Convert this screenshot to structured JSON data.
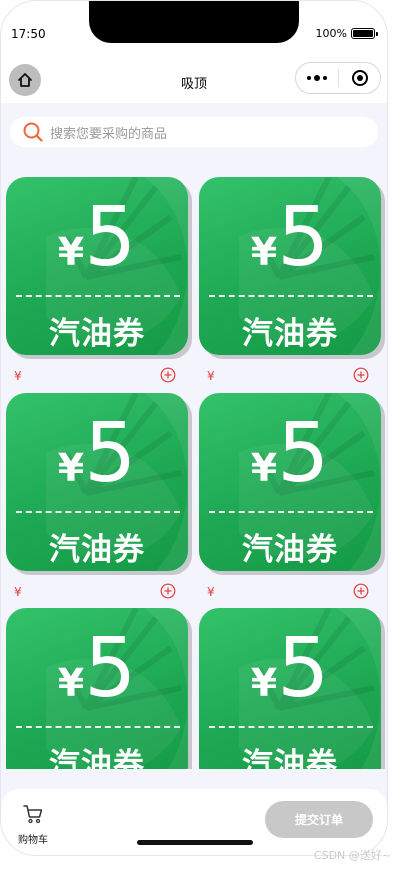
{
  "status_bar": {
    "time": "17:50",
    "battery_text": "100%",
    "battery_level": 1.0
  },
  "nav": {
    "title": "吸顶",
    "home_icon": "home-icon",
    "more_icon": "more-dots-icon",
    "close_icon": "target-icon"
  },
  "search": {
    "placeholder": "搜索您要采购的商品",
    "icon": "search-icon",
    "accent": "#f0663a"
  },
  "products": [
    {
      "amount": "5",
      "currency": "¥",
      "name": "汽油券",
      "price": "¥"
    },
    {
      "amount": "5",
      "currency": "¥",
      "name": "汽油券",
      "price": "¥"
    },
    {
      "amount": "5",
      "currency": "¥",
      "name": "汽油券",
      "price": "¥"
    },
    {
      "amount": "5",
      "currency": "¥",
      "name": "汽油券",
      "price": "¥"
    },
    {
      "amount": "5",
      "currency": "¥",
      "name": "汽油券",
      "price": "¥"
    },
    {
      "amount": "5",
      "currency": "¥",
      "name": "汽油券",
      "price": "¥"
    }
  ],
  "bottom": {
    "cart_label": "购物车",
    "submit_label": "提交订单",
    "cart_icon": "cart-icon"
  },
  "watermark": "CSDN @送好~",
  "colors": {
    "coupon_green": "#1ea853",
    "price_red": "#e33b3b",
    "submit_disabled": "#c8c8c8",
    "page_bg": "#f3f4fc"
  }
}
